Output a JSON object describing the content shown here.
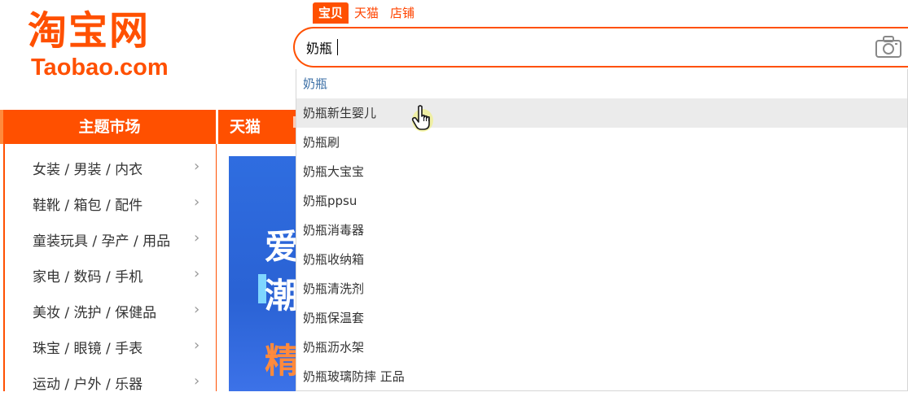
{
  "logo": {
    "cn": "淘宝网",
    "en": "Taobao.com",
    "color": "#ff5000"
  },
  "search": {
    "tabs": [
      "宝贝",
      "天猫",
      "店铺"
    ],
    "active_tab": 0,
    "value": "奶瓶",
    "camera_icon": "camera-icon"
  },
  "suggestions": [
    "奶瓶",
    "奶瓶新生婴儿",
    "奶瓶刷",
    "奶瓶大宝宝",
    "奶瓶ppsu",
    "奶瓶消毒器",
    "奶瓶收纳箱",
    "奶瓶清洗剂",
    "奶瓶保温套",
    "奶瓶沥水架",
    "奶瓶玻璃防摔 正品"
  ],
  "nav": {
    "sidebar_title": "主题市场",
    "tab_tmall": "天猫"
  },
  "categories": [
    "女装 / 男装 / 内衣",
    "鞋靴 / 箱包 / 配件",
    "童装玩具 / 孕产 / 用品",
    "家电 / 数码 / 手机",
    "美妆 / 洗护 / 保健品",
    "珠宝 / 眼镜 / 手表",
    "运动 / 户外 / 乐器"
  ],
  "banner": {
    "chars": [
      "爱",
      "潮",
      "精"
    ]
  },
  "colors": {
    "brand": "#ff5000",
    "hover_row": "#ebebeb",
    "first_suggestion": "#3a6ea5"
  }
}
